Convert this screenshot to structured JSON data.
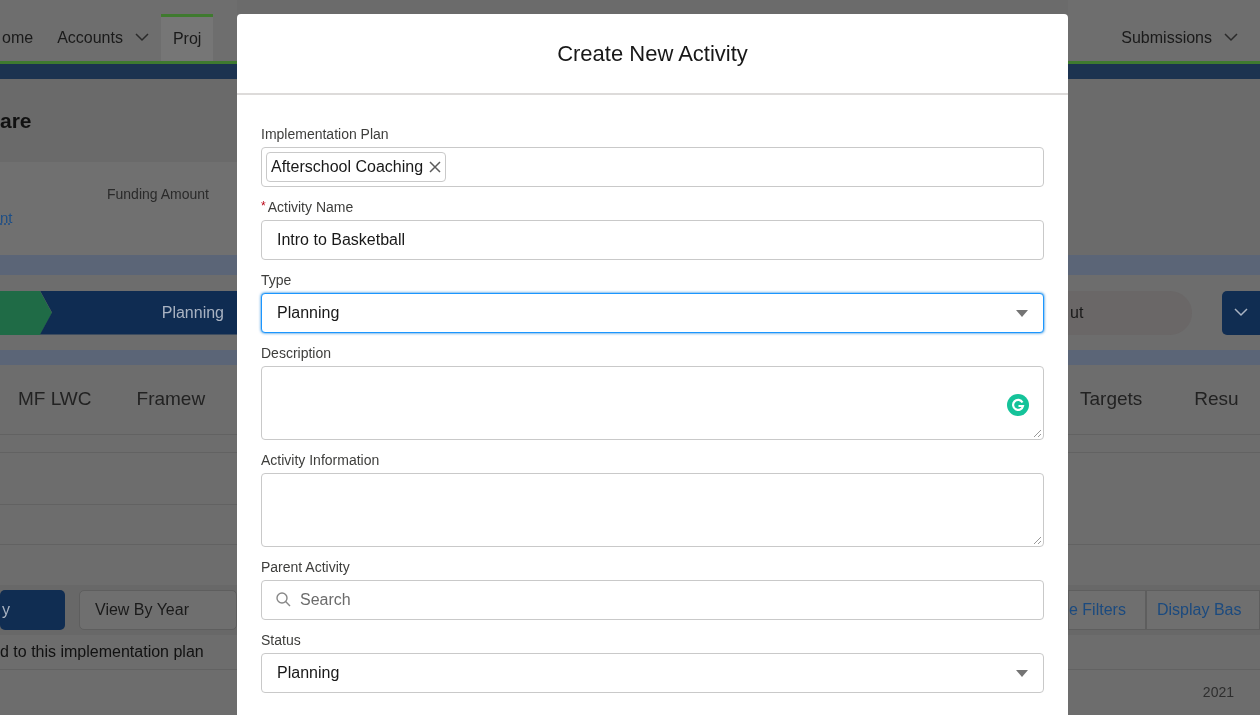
{
  "background": {
    "left": {
      "nav": [
        {
          "label": "ome",
          "dropdown": false,
          "selected": false
        },
        {
          "label": "Accounts",
          "dropdown": true,
          "selected": false
        },
        {
          "label": "Proj",
          "dropdown": false,
          "selected": true
        }
      ],
      "header_title": "are",
      "field_label": "Funding Amount",
      "field_link": "nt",
      "path": [
        {
          "kind": "complete"
        },
        {
          "kind": "current",
          "label": "Planning"
        }
      ],
      "tabs": [
        "MF LWC",
        "Framew"
      ],
      "buttons": [
        {
          "kind": "brand",
          "label": "y"
        },
        {
          "kind": "neutral",
          "label": "View By Year"
        }
      ],
      "note": "d to this implementation plan"
    },
    "right": {
      "nav": [
        {
          "label": "Submissions",
          "dropdown": true,
          "selected": false
        }
      ],
      "path_stage": "ut",
      "tabs": [
        "Targets",
        "Resu"
      ],
      "buttons": [
        "e Filters",
        "Display Bas"
      ],
      "year": "2021"
    }
  },
  "modal": {
    "title": "Create New Activity",
    "fields": [
      {
        "kind": "pill",
        "label": "Implementation Plan",
        "value": "Afterschool Coaching"
      },
      {
        "kind": "text",
        "label": "Activity Name",
        "required_mark": "*",
        "value": "Intro to Basketball"
      },
      {
        "kind": "select",
        "label": "Type",
        "value": "Planning",
        "focused": true
      },
      {
        "kind": "textarea",
        "label": "Description",
        "grammarly": true
      },
      {
        "kind": "textarea",
        "label": "Activity Information",
        "grammarly": false
      },
      {
        "kind": "search",
        "label": "Parent Activity",
        "placeholder": "Search"
      },
      {
        "kind": "select",
        "label": "Status",
        "value": "Planning",
        "focused": false
      }
    ]
  }
}
